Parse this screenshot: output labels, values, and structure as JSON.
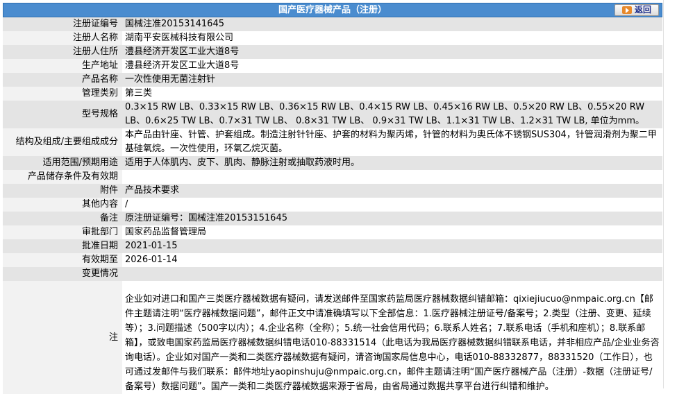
{
  "header": {
    "title": "国产医疗器械产品（注册）",
    "back_label": "返回"
  },
  "rows": [
    {
      "label": "注册证编号",
      "value": "国械注准20153141645"
    },
    {
      "label": "注册人名称",
      "value": "湖南平安医械科技有限公司"
    },
    {
      "label": "注册人住所",
      "value": "澧县经济开发区工业大道8号"
    },
    {
      "label": "生产地址",
      "value": "澧县经济开发区工业大道8号"
    },
    {
      "label": "产品名称",
      "value": "一次性使用无菌注射针"
    },
    {
      "label": "管理类别",
      "value": "第三类"
    },
    {
      "label": "型号规格",
      "value": "0.3×15 RW LB、0.33×15 RW LB、0.36×15 RW LB、0.4×15 RW LB、0.45×16 RW LB、0.5×20 RW LB、0.55×20 RW LB、0.6×25 TW LB、0.7×31 TW LB、 0.8×31 TW LB、 0.9×31 TW LB、1.1×31 TW LB、1.2×31 TW LB, 单位为mm。"
    },
    {
      "label": "结构及组成/主要组成成分",
      "value": "本产品由针座、针管、护套组成。制造注射针针座、护套的材料为聚丙烯，针管的材料为奥氏体不锈钢SUS304，针管润滑剂为聚二甲基硅氧烷。一次性使用，环氧乙烷灭菌。"
    },
    {
      "label": "适用范围/预期用途",
      "value": "适用于人体肌内、皮下、肌肉、静脉注射或抽取药液时用。"
    },
    {
      "label": "产品储存条件及有效期",
      "value": ""
    },
    {
      "label": "附件",
      "value": "产品技术要求"
    },
    {
      "label": "其他内容",
      "value": "/"
    },
    {
      "label": "备注",
      "value": "原注册证编号：国械注准20153151645"
    },
    {
      "label": "审批部门",
      "value": "国家药品监督管理局"
    },
    {
      "label": "批准日期",
      "value": "2021-01-15"
    },
    {
      "label": "有效期至",
      "value": "2026-01-14"
    },
    {
      "label": "变更情况",
      "value": ""
    }
  ],
  "note": {
    "label": "注",
    "text": "企业如对进口和国产三类医疗器械数据有疑问，请发送邮件至国家药监局医疗器械数据纠错邮箱：qixiejiucuo@nmpaic.org.cn【邮件主题请注明“医疗器械数据问题”，邮件正文中请准确填写以下全部信息：1.医疗器械注册证号/备案号；2.类型（注册、变更、延续等）；3.问题描述（500字以内）；4.企业名称（全称）；5.统一社会信用代码；6.联系人姓名；7.联系电话（手机和座机）；8.联系邮箱】，或致电国家药监局医疗器械数据纠错电话010-88331514（此电话为我局医疗器械数据纠错联系电话，并非相应产品/企业业务咨询电话）。企业如对国产一类和二类医疗器械数据有疑问，请咨询国家局信息中心，电话010-88332877，88331520（工作日），也可通过发邮件与我们联系：邮件地址yaopinshuju@nmpaic.org.cn，邮件主题请注明“国产医疗器械产品（注册）-数据（注册证号/备案号）数据问题”。国产一类和二类医疗器械数据来源于省局，由省局通过数据共享平台进行纠错和维护。"
  }
}
